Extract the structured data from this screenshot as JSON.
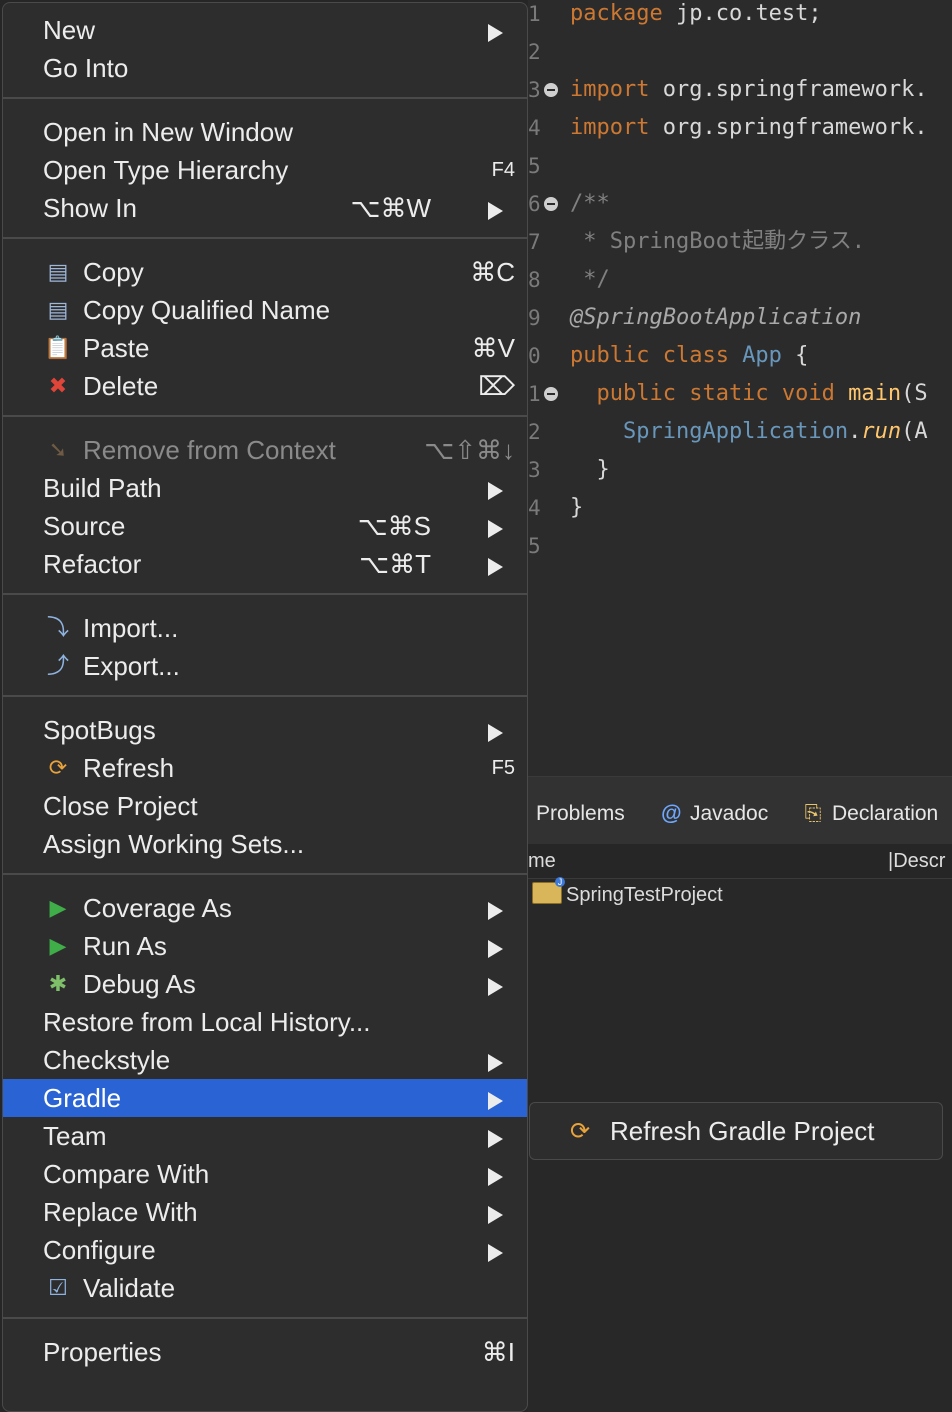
{
  "editor": {
    "lines": [
      {
        "num": "1",
        "parts": [
          {
            "t": "package ",
            "c": "kw"
          },
          {
            "t": "jp.co.test;",
            "c": "pl"
          }
        ]
      },
      {
        "num": "2",
        "parts": []
      },
      {
        "num": "3",
        "fold": true,
        "parts": [
          {
            "t": "import ",
            "c": "kw"
          },
          {
            "t": "org.springframework.",
            "c": "pl"
          }
        ]
      },
      {
        "num": "4",
        "parts": [
          {
            "t": "import ",
            "c": "kw"
          },
          {
            "t": "org.springframework.",
            "c": "pl"
          }
        ]
      },
      {
        "num": "5",
        "parts": []
      },
      {
        "num": "6",
        "fold": true,
        "parts": [
          {
            "t": "/**",
            "c": "cm"
          }
        ]
      },
      {
        "num": "7",
        "parts": [
          {
            "t": " * SpringBoot起動クラス.",
            "c": "cm"
          }
        ]
      },
      {
        "num": "8",
        "parts": [
          {
            "t": " */",
            "c": "cm"
          }
        ]
      },
      {
        "num": "9",
        "parts": [
          {
            "t": "@SpringBootApplication",
            "c": "an"
          }
        ]
      },
      {
        "num": "0",
        "parts": [
          {
            "t": "public class ",
            "c": "kw"
          },
          {
            "t": "App ",
            "c": "ty"
          },
          {
            "t": "{",
            "c": "pl"
          }
        ]
      },
      {
        "num": "1",
        "fold": true,
        "parts": [
          {
            "t": "  public static void ",
            "c": "kw"
          },
          {
            "t": "main",
            "c": "fn"
          },
          {
            "t": "(S",
            "c": "pl"
          }
        ]
      },
      {
        "num": "2",
        "parts": [
          {
            "t": "    SpringApplication",
            "c": "ty"
          },
          {
            "t": ".",
            "c": "pl"
          },
          {
            "t": "run",
            "c": "fn it"
          },
          {
            "t": "(A",
            "c": "pl"
          }
        ]
      },
      {
        "num": "3",
        "parts": [
          {
            "t": "  }",
            "c": "pl"
          }
        ]
      },
      {
        "num": "4",
        "parts": [
          {
            "t": "}",
            "c": "pl"
          }
        ]
      },
      {
        "num": "5",
        "parts": []
      }
    ]
  },
  "panel": {
    "tabs": [
      {
        "icon": "",
        "label": "Problems"
      },
      {
        "icon": "@",
        "label": "Javadoc"
      },
      {
        "icon": "⎘",
        "label": "Declaration"
      }
    ],
    "col_name": "me",
    "col_desc": "|Descr",
    "project": "SpringTestProject"
  },
  "menu": {
    "items": [
      {
        "label": "New",
        "submenu": true
      },
      {
        "label": "Go Into"
      },
      {
        "sep": true
      },
      {
        "label": "Open in New Window"
      },
      {
        "label": "Open Type Hierarchy",
        "shortcut": "F4"
      },
      {
        "label": "Show In",
        "shortcut": "⌥⌘W",
        "submenu": true
      },
      {
        "sep": true
      },
      {
        "label": "Copy",
        "icon": "copy",
        "shortcut": "⌘C"
      },
      {
        "label": "Copy Qualified Name",
        "icon": "copy-qualified"
      },
      {
        "label": "Paste",
        "icon": "paste",
        "shortcut": "⌘V"
      },
      {
        "label": "Delete",
        "icon": "delete",
        "shortcut": "⌦"
      },
      {
        "sep": true
      },
      {
        "label": "Remove from Context",
        "icon": "remove-context",
        "shortcut": "⌥⇧⌘↓",
        "disabled": true
      },
      {
        "label": "Build Path",
        "submenu": true
      },
      {
        "label": "Source",
        "shortcut": "⌥⌘S",
        "submenu": true
      },
      {
        "label": "Refactor",
        "shortcut": "⌥⌘T",
        "submenu": true
      },
      {
        "sep": true
      },
      {
        "label": "Import...",
        "icon": "import"
      },
      {
        "label": "Export...",
        "icon": "export"
      },
      {
        "sep": true
      },
      {
        "label": "SpotBugs",
        "submenu": true
      },
      {
        "label": "Refresh",
        "icon": "refresh",
        "shortcut": "F5"
      },
      {
        "label": "Close Project"
      },
      {
        "label": "Assign Working Sets..."
      },
      {
        "sep": true
      },
      {
        "label": "Coverage As",
        "icon": "coverage",
        "submenu": true
      },
      {
        "label": "Run As",
        "icon": "run",
        "submenu": true
      },
      {
        "label": "Debug As",
        "icon": "debug",
        "submenu": true
      },
      {
        "label": "Restore from Local History..."
      },
      {
        "label": "Checkstyle",
        "submenu": true
      },
      {
        "label": "Gradle",
        "submenu": true,
        "highlighted": true
      },
      {
        "label": "Team",
        "submenu": true
      },
      {
        "label": "Compare With",
        "submenu": true
      },
      {
        "label": "Replace With",
        "submenu": true
      },
      {
        "label": "Configure",
        "submenu": true
      },
      {
        "label": "Validate",
        "icon": "validate"
      },
      {
        "sep": true
      },
      {
        "label": "Properties",
        "shortcut": "⌘I"
      }
    ]
  },
  "submenu": {
    "label": "Refresh Gradle Project",
    "icon": "refresh"
  },
  "colors": {
    "highlight": "#2a64d4",
    "keyword": "#cc7832",
    "type": "#6897bb",
    "method": "#ffc66d"
  }
}
